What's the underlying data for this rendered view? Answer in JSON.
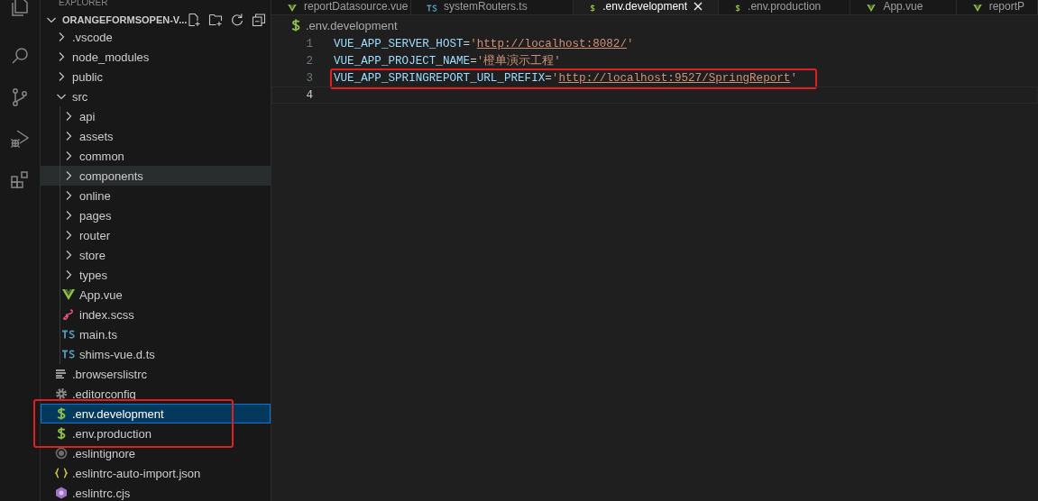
{
  "explorer": {
    "title": "EXPLORER",
    "root": {
      "label": "ORANGEFORMSOPEN-V...",
      "expanded": true
    },
    "tree": [
      {
        "label": ".vscode",
        "kind": "folder",
        "expanded": false,
        "selected": false,
        "hovered": false,
        "highlighted": false
      },
      {
        "label": "node_modules",
        "kind": "folder",
        "expanded": false,
        "selected": false,
        "hovered": false,
        "highlighted": false
      },
      {
        "label": "public",
        "kind": "folder",
        "expanded": false,
        "selected": false,
        "hovered": false,
        "highlighted": false
      },
      {
        "label": "src",
        "kind": "folder",
        "expanded": true,
        "selected": false,
        "hovered": false,
        "highlighted": false,
        "children": [
          {
            "label": "api",
            "kind": "folder",
            "expanded": false,
            "selected": false,
            "hovered": false,
            "highlighted": false
          },
          {
            "label": "assets",
            "kind": "folder",
            "expanded": false,
            "selected": false,
            "hovered": false,
            "highlighted": false
          },
          {
            "label": "common",
            "kind": "folder",
            "expanded": false,
            "selected": false,
            "hovered": false,
            "highlighted": false
          },
          {
            "label": "components",
            "kind": "folder",
            "expanded": false,
            "selected": false,
            "hovered": true,
            "highlighted": false
          },
          {
            "label": "online",
            "kind": "folder",
            "expanded": false,
            "selected": false,
            "hovered": false,
            "highlighted": false
          },
          {
            "label": "pages",
            "kind": "folder",
            "expanded": false,
            "selected": false,
            "hovered": false,
            "highlighted": false
          },
          {
            "label": "router",
            "kind": "folder",
            "expanded": false,
            "selected": false,
            "hovered": false,
            "highlighted": false
          },
          {
            "label": "store",
            "kind": "folder",
            "expanded": false,
            "selected": false,
            "hovered": false,
            "highlighted": false
          },
          {
            "label": "types",
            "kind": "folder",
            "expanded": false,
            "selected": false,
            "hovered": false,
            "highlighted": false
          },
          {
            "label": "App.vue",
            "kind": "vue",
            "selected": false,
            "hovered": false,
            "highlighted": false
          },
          {
            "label": "index.scss",
            "kind": "scss",
            "selected": false,
            "hovered": false,
            "highlighted": false
          },
          {
            "label": "main.ts",
            "kind": "ts",
            "selected": false,
            "hovered": false,
            "highlighted": false
          },
          {
            "label": "shims-vue.d.ts",
            "kind": "ts",
            "selected": false,
            "hovered": false,
            "highlighted": false
          }
        ]
      },
      {
        "label": ".browserslistrc",
        "kind": "lines",
        "selected": false,
        "hovered": false,
        "highlighted": false
      },
      {
        "label": ".editorconfig",
        "kind": "gear",
        "selected": false,
        "hovered": false,
        "highlighted": false
      },
      {
        "label": ".env.development",
        "kind": "env",
        "selected": true,
        "hovered": false,
        "highlighted": true
      },
      {
        "label": ".env.production",
        "kind": "env",
        "selected": false,
        "hovered": false,
        "highlighted": true
      },
      {
        "label": ".eslintignore",
        "kind": "ignore",
        "selected": false,
        "hovered": false,
        "highlighted": false
      },
      {
        "label": ".eslintrc-auto-import.json",
        "kind": "json",
        "selected": false,
        "hovered": false,
        "highlighted": false
      },
      {
        "label": ".eslintrc.cjs",
        "kind": "eslint",
        "selected": false,
        "hovered": false,
        "highlighted": false
      }
    ]
  },
  "tabs": [
    {
      "label": "reportDatasource.vue",
      "kind": "vue",
      "selected": false
    },
    {
      "label": "systemRouters.ts",
      "kind": "ts",
      "selected": false
    },
    {
      "label": ".env.development",
      "kind": "env",
      "selected": true
    },
    {
      "label": ".env.production",
      "kind": "env",
      "selected": false
    },
    {
      "label": "App.vue",
      "kind": "vue",
      "selected": false
    },
    {
      "label": "reportP",
      "kind": "vue",
      "selected": false
    }
  ],
  "breadcrumb": {
    "kind": "env",
    "label": ".env.development"
  },
  "code_lines": [
    {
      "number": "1",
      "current": false,
      "highlighted": false,
      "tokens": [
        {
          "kind": "key",
          "text": "VUE_APP_SERVER_HOST"
        },
        {
          "kind": "op",
          "text": "="
        },
        {
          "kind": "string",
          "text": "'"
        },
        {
          "kind": "link",
          "text": "http://localhost:8082/"
        },
        {
          "kind": "string",
          "text": "'"
        }
      ]
    },
    {
      "number": "2",
      "current": false,
      "highlighted": false,
      "tokens": [
        {
          "kind": "key",
          "text": "VUE_APP_PROJECT_NAME"
        },
        {
          "kind": "op",
          "text": "="
        },
        {
          "kind": "string",
          "text": "'橙单演示工程'"
        }
      ]
    },
    {
      "number": "3",
      "current": false,
      "highlighted": true,
      "tokens": [
        {
          "kind": "key",
          "text": "VUE_APP_SPRINGREPORT_URL_PREFIX"
        },
        {
          "kind": "op",
          "text": "="
        },
        {
          "kind": "string",
          "text": "'"
        },
        {
          "kind": "link",
          "text": "http://localhost:9527/SpringReport"
        },
        {
          "kind": "string",
          "text": "'"
        }
      ]
    },
    {
      "number": "4",
      "current": true,
      "highlighted": false
    }
  ]
}
